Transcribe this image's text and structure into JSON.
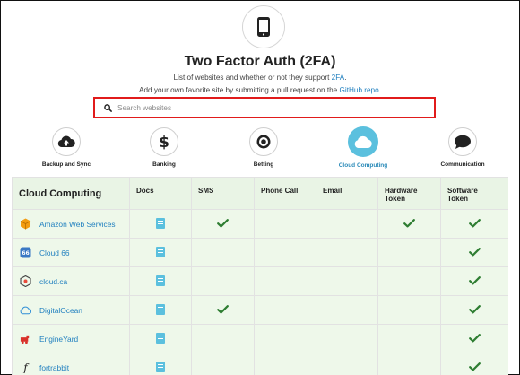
{
  "header": {
    "logo_icon": "smartphone-icon",
    "title": "Two Factor Auth (2FA)",
    "subtitle_prefix": "List of websites and whether or not they support ",
    "subtitle_link": "2FA",
    "subtitle_suffix": ".",
    "contribute_prefix": "Add your own favorite site by submitting a pull request on the ",
    "contribute_link": "GitHub repo",
    "contribute_suffix": "."
  },
  "search": {
    "placeholder": "Search websites",
    "icon": "search-icon"
  },
  "categories": [
    {
      "label": "Backup and Sync",
      "icon": "cloud-upload-icon",
      "active": false
    },
    {
      "label": "Banking",
      "icon": "dollar-icon",
      "active": false
    },
    {
      "label": "Betting",
      "icon": "target-icon",
      "active": false
    },
    {
      "label": "Cloud Computing",
      "icon": "cloud-icon",
      "active": true
    },
    {
      "label": "Communication",
      "icon": "chat-bubble-icon",
      "active": false
    }
  ],
  "table": {
    "headers": {
      "name": "Cloud Computing",
      "docs": "Docs",
      "sms": "SMS",
      "phone": "Phone Call",
      "email": "Email",
      "hardware_1": "Hardware",
      "hardware_2": "Token",
      "software_1": "Software",
      "software_2": "Token"
    },
    "rows": [
      {
        "name": "Amazon Web Services",
        "logo": "aws-logo",
        "docs": true,
        "sms": true,
        "phone": false,
        "email": false,
        "hardware": true,
        "software": true
      },
      {
        "name": "Cloud 66",
        "logo": "cloud66-logo",
        "docs": true,
        "sms": false,
        "phone": false,
        "email": false,
        "hardware": false,
        "software": true
      },
      {
        "name": "cloud.ca",
        "logo": "cloudca-logo",
        "docs": true,
        "sms": false,
        "phone": false,
        "email": false,
        "hardware": false,
        "software": true
      },
      {
        "name": "DigitalOcean",
        "logo": "digitalocean-logo",
        "docs": true,
        "sms": true,
        "phone": false,
        "email": false,
        "hardware": false,
        "software": true
      },
      {
        "name": "EngineYard",
        "logo": "engineyard-logo",
        "docs": true,
        "sms": false,
        "phone": false,
        "email": false,
        "hardware": false,
        "software": true
      },
      {
        "name": "fortrabbit",
        "logo": "fortrabbit-logo",
        "docs": true,
        "sms": false,
        "phone": false,
        "email": false,
        "hardware": false,
        "software": true
      }
    ]
  },
  "colors": {
    "accent": "#5bc0de",
    "link": "#1f7fbf",
    "check": "#2e7d32",
    "row_bg": "#eef8ea",
    "highlight": "#e11b1b"
  }
}
